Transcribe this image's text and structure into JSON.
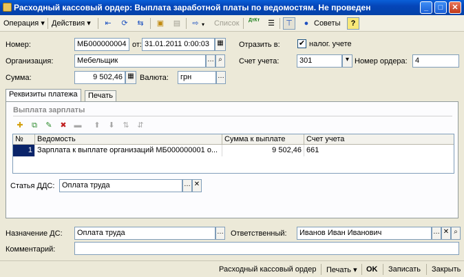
{
  "window": {
    "title": "Расходный кассовый ордер: Выплата заработной платы по ведомостям. Не проведен",
    "minimize": "_",
    "maximize": "□",
    "close": "✕"
  },
  "toolbar": {
    "operation_menu": "Операция",
    "actions_menu": "Действия",
    "list_button": "Список",
    "dtkt_icon_label": "ДтКт",
    "tips_button": "Советы",
    "help_button": "?"
  },
  "form": {
    "number_label": "Номер:",
    "number_value": "МБ000000004",
    "date_label": "от:",
    "date_value": "31.01.2011  0:00:03",
    "reflect_label": "Отразить в:",
    "tax_accounting_label": "налог. учете",
    "tax_accounting_checked": "✔",
    "organization_label": "Организация:",
    "organization_value": "Мебельщик",
    "account_label": "Счет учета:",
    "account_value": "301",
    "order_number_label": "Номер ордера:",
    "order_number_value": "4",
    "amount_label": "Сумма:",
    "amount_value": "9 502,46",
    "currency_label": "Валюта:",
    "currency_value": "грн"
  },
  "tabs": [
    {
      "label": "Реквизиты платежа",
      "active": true
    },
    {
      "label": "Печать",
      "active": false
    }
  ],
  "payment": {
    "group_title": "Выплата зарплаты",
    "columns": [
      "№",
      "Ведомость",
      "Сумма к выплате",
      "Счет учета"
    ],
    "rows": [
      {
        "num": "1",
        "statement": "Зарплата к выплате организаций МБ000000001 о...",
        "amount": "9 502,46",
        "account": "661"
      }
    ],
    "dds_label": "Статья ДДС:",
    "dds_value": "Оплата труда"
  },
  "footer_fields": {
    "purpose_label": "Назначение ДС:",
    "purpose_value": "Оплата труда",
    "responsible_label": "Ответственный:",
    "responsible_value": "Иванов Иван Иванович",
    "comment_label": "Комментарий:",
    "comment_value": ""
  },
  "bottom": {
    "doc_button": "Расходный кассовый ордер",
    "print_button": "Печать",
    "ok_button": "OK",
    "save_button": "Записать",
    "close_button": "Закрыть"
  },
  "colors": {
    "titlebar": "#0545b8",
    "selected_cell": "#0a246a",
    "window_bg": "#ece9d8"
  }
}
